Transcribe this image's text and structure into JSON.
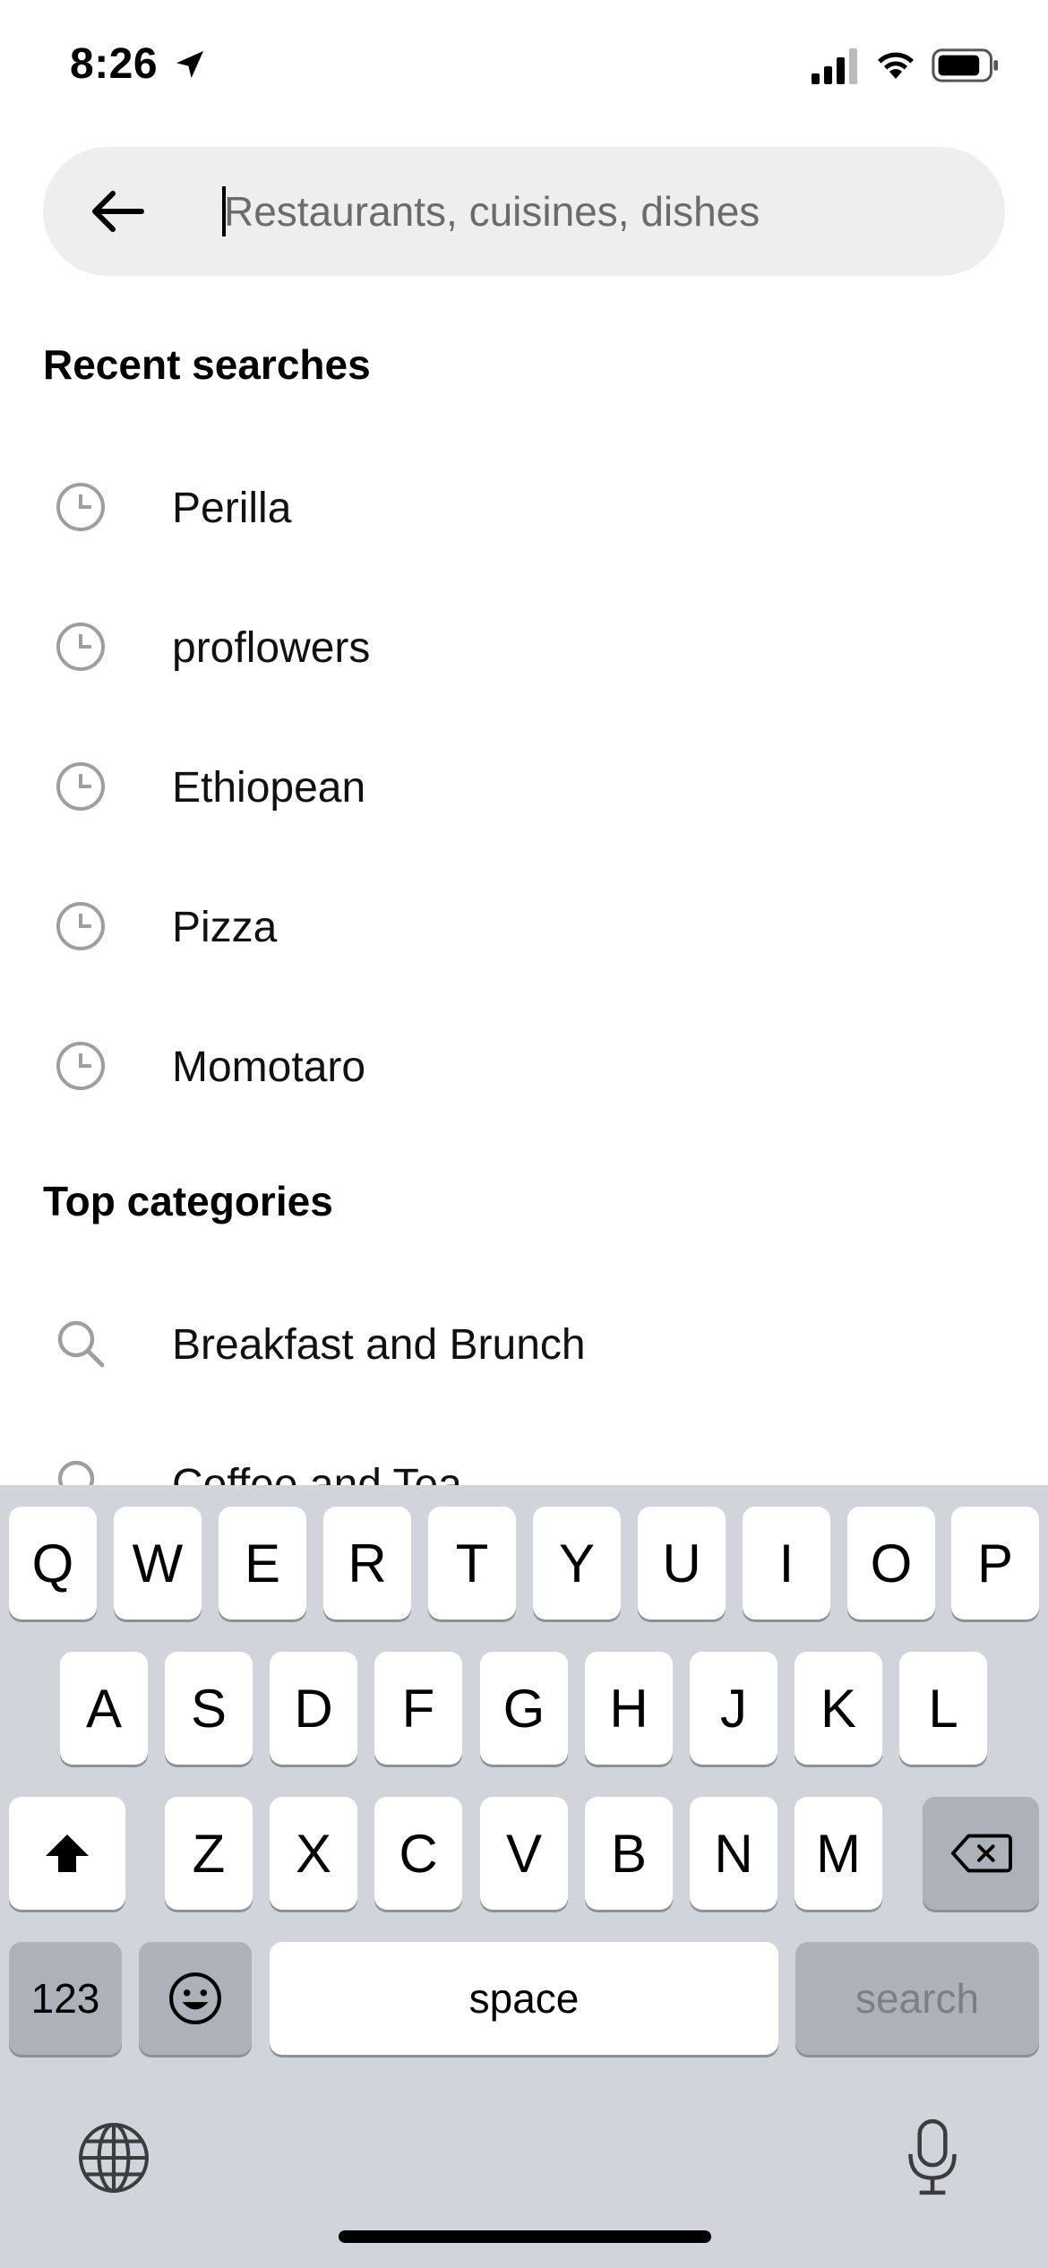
{
  "status_bar": {
    "time": "8:26",
    "icons": [
      "location-arrow-icon",
      "cellular-signal-icon",
      "wifi-icon",
      "battery-icon"
    ]
  },
  "search": {
    "placeholder": "Restaurants, cuisines, dishes",
    "value": ""
  },
  "recent_searches": {
    "heading": "Recent searches",
    "items": [
      {
        "label": "Perilla",
        "icon": "clock-icon"
      },
      {
        "label": "proflowers",
        "icon": "clock-icon"
      },
      {
        "label": "Ethiopean",
        "icon": "clock-icon"
      },
      {
        "label": "Pizza",
        "icon": "clock-icon"
      },
      {
        "label": "Momotaro",
        "icon": "clock-icon"
      }
    ]
  },
  "top_categories": {
    "heading": "Top categories",
    "items": [
      {
        "label": "Breakfast and Brunch",
        "icon": "search-icon"
      },
      {
        "label": "Coffee and Tea",
        "icon": "search-icon"
      }
    ]
  },
  "keyboard": {
    "row1": [
      "Q",
      "W",
      "E",
      "R",
      "T",
      "Y",
      "U",
      "I",
      "O",
      "P"
    ],
    "row2": [
      "A",
      "S",
      "D",
      "F",
      "G",
      "H",
      "J",
      "K",
      "L"
    ],
    "row3": [
      "Z",
      "X",
      "C",
      "V",
      "B",
      "N",
      "M"
    ],
    "numbers_label": "123",
    "space_label": "space",
    "search_label": "search",
    "icons": [
      "shift-icon",
      "backspace-icon",
      "emoji-icon",
      "globe-icon",
      "microphone-icon"
    ]
  },
  "colors": {
    "search_bar_bg": "#eeeeee",
    "placeholder": "#6b6b6b",
    "icon_gray": "#9e9e9e",
    "keyboard_bg": "#d1d4da",
    "dark_key": "#adb1b9"
  }
}
